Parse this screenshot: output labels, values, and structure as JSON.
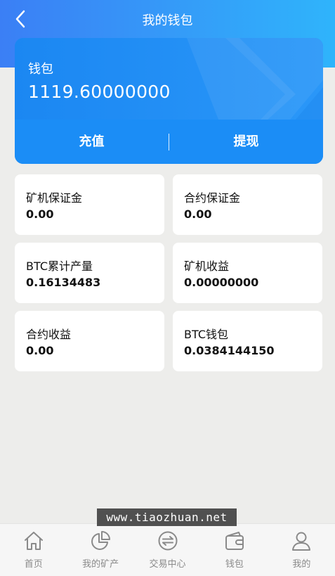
{
  "header": {
    "title": "我的钱包",
    "back_icon": "chevron-left-icon"
  },
  "wallet": {
    "label": "钱包",
    "balance": "1119.60000000",
    "recharge_label": "充值",
    "withdraw_label": "提现"
  },
  "stats": [
    {
      "label": "矿机保证金",
      "value": "0.00"
    },
    {
      "label": "合约保证金",
      "value": "0.00"
    },
    {
      "label": "BTC累计产量",
      "value": "0.16134483"
    },
    {
      "label": "矿机收益",
      "value": "0.00000000"
    },
    {
      "label": "合约收益",
      "value": "0.00"
    },
    {
      "label": "BTC钱包",
      "value": "0.0384144150"
    }
  ],
  "watermark": "www.tiaozhuan.net",
  "tabbar": [
    {
      "label": "首页",
      "icon": "home-icon"
    },
    {
      "label": "我的矿产",
      "icon": "pie-chart-icon"
    },
    {
      "label": "交易中心",
      "icon": "exchange-icon"
    },
    {
      "label": "钱包",
      "icon": "wallet-icon"
    },
    {
      "label": "我的",
      "icon": "user-icon"
    }
  ],
  "colors": {
    "header_gradient_start": "#3b7ff5",
    "header_gradient_end": "#2fb4fb",
    "card_blue": "#1b8df6",
    "background": "#ededeb",
    "tab_gray": "#8a8a8a"
  }
}
